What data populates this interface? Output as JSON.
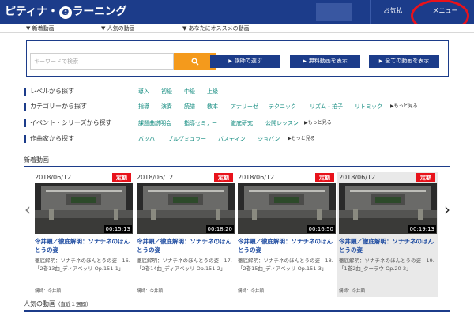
{
  "header": {
    "logo_pre": "ピティナ・",
    "logo_mark": "e",
    "logo_post": "ラーニング",
    "favorites": "お気払",
    "menu": "メニュー",
    "accent": "#1c3c8a",
    "highlight": "#e8121b"
  },
  "subnav": [
    {
      "label": "▼ 新着動画"
    },
    {
      "label": "▼ 人気の動画"
    },
    {
      "label": "▼ あなたにオススメの動画"
    }
  ],
  "search": {
    "placeholder": "キーワードで検索",
    "button_icon": "search-icon",
    "buttons": [
      {
        "label": "講師で選ぶ"
      },
      {
        "label": "無料動画を表示"
      },
      {
        "label": "全ての動画を表示"
      }
    ]
  },
  "filters": [
    {
      "label": "レベルから探す",
      "links": [
        "導入",
        "初級",
        "中級",
        "上級"
      ],
      "more": ""
    },
    {
      "label": "カテゴリーから探す",
      "links": [
        "指導",
        "演奏",
        "読譜",
        "教本",
        "アナリーゼ",
        "テクニック",
        "リズム・拍子",
        "リトミック"
      ],
      "more": "▶もっと見る"
    },
    {
      "label": "イベント・シリーズから探す",
      "links": [
        "課題曲説明会",
        "指導セミナー",
        "徹底研究",
        "公開レッスン"
      ],
      "more": "▶もっと見る"
    },
    {
      "label": "作曲家から探す",
      "links": [
        "バッハ",
        "ブルグミュラー",
        "バスティン",
        "ショパン"
      ],
      "more": "▶もっと見る"
    }
  ],
  "new_videos": {
    "title": "新着動画",
    "prev_icon": "chevron-left-icon",
    "next_icon": "chevron-right-icon",
    "cards": [
      {
        "date": "2018/06/12",
        "badge": "定額",
        "duration": "00:15:13",
        "title": "今井顕／徹底解明：ソナチネのほんとうの姿",
        "desc": "徹底解明：ソナチネのほんとうの姿　16.「2巻13曲_ディアベッリ Op.151-1」",
        "lecturer": "講師：今井顕"
      },
      {
        "date": "2018/06/12",
        "badge": "定額",
        "duration": "00:18:20",
        "title": "今井顕／徹底解明：ソナチネのほんとうの姿",
        "desc": "徹底解明：ソナチネのほんとうの姿　17.「2巻14曲_ディアベッリ Op.151-2」",
        "lecturer": "講師：今井顕"
      },
      {
        "date": "2018/06/12",
        "badge": "定額",
        "duration": "00:16:50",
        "title": "今井顕／徹底解明：ソナチネのほんとうの姿",
        "desc": "徹底解明：ソナチネのほんとうの姿　18.「2巻15曲_ディアベッリ Op.151-3」",
        "lecturer": "講師：今井顕"
      },
      {
        "date": "2018/06/12",
        "badge": "定額",
        "duration": "00:19:13",
        "title": "今井顕／徹底解明：ソナチネのほんとうの姿",
        "desc": "徹底解明：ソナチネのほんとうの姿　19.「1巻2曲_クーラウ Op.20-2」",
        "lecturer": "講師：今井顕"
      }
    ]
  },
  "popular": {
    "title": "人気の動画",
    "sub": "（直近１週間）"
  }
}
